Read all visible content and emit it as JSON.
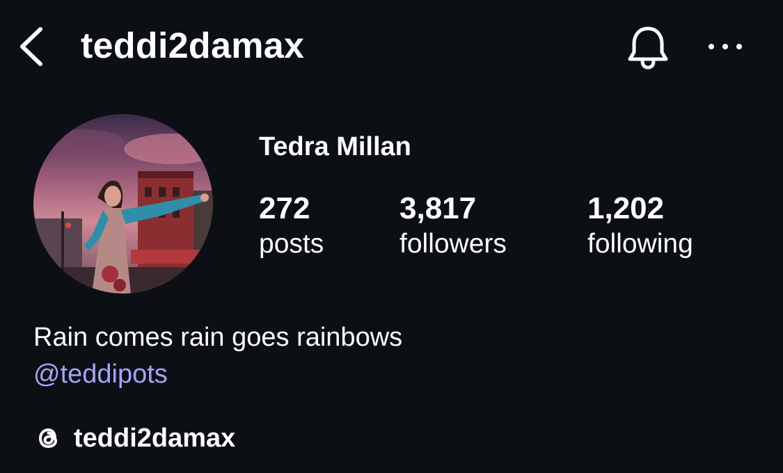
{
  "header": {
    "back_icon": "chevron-left-icon",
    "username": "teddi2damax",
    "bell_icon": "bell-icon",
    "more_icon": "more-horizontal-icon"
  },
  "profile": {
    "avatar_icon": "profile-photo",
    "display_name": "Tedra Millan",
    "stats": {
      "posts": {
        "count": "272",
        "label": "posts"
      },
      "followers": {
        "count": "3,817",
        "label": "followers"
      },
      "following": {
        "count": "1,202",
        "label": "following"
      }
    },
    "bio": "Rain comes rain goes rainbows",
    "mention": "@teddipots",
    "threads": {
      "icon": "threads-icon",
      "label": "teddi2damax"
    }
  },
  "colors": {
    "background": "#0c0f14",
    "text": "#ffffff",
    "mention": "#a4a6f5"
  }
}
